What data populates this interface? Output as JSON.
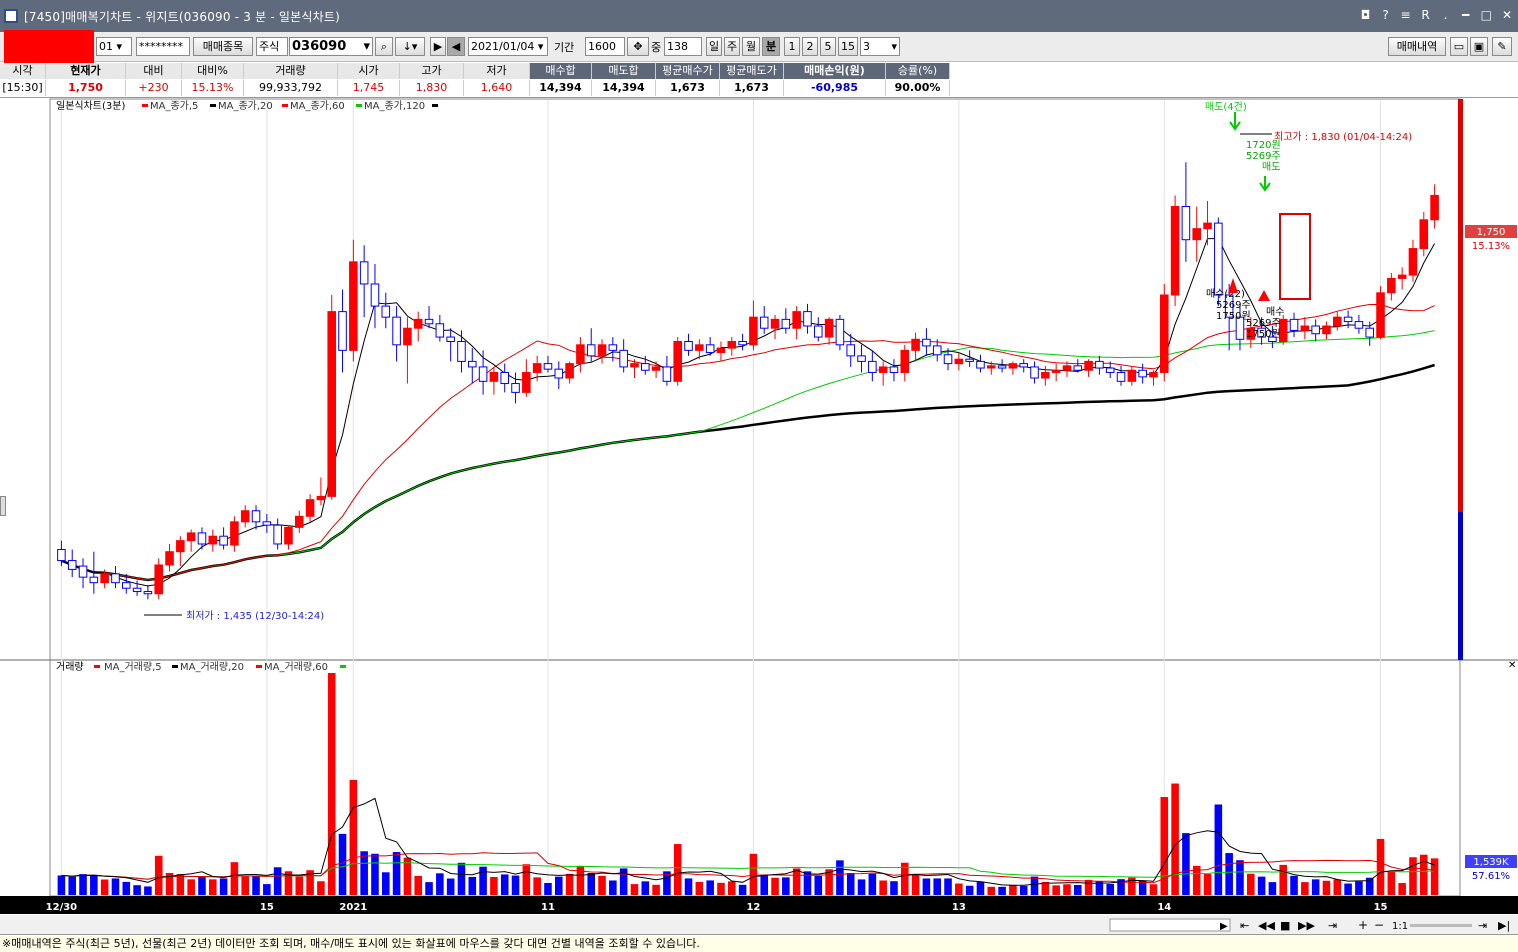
{
  "window": {
    "title": "[7450]매매복기차트 - 위지트(036090 - 3 분 - 일본식차트)",
    "controls": [
      "◘",
      "?",
      "≡",
      "R",
      ".",
      "━",
      "□",
      "✕"
    ]
  },
  "toolbar": {
    "account_suffix": "01",
    "password": "********",
    "trade_items_btn": "매매종목",
    "market_select": "주식",
    "code": "036090",
    "date": "2021/01/04",
    "period_label": "기간",
    "period_value": "1600",
    "weight_label": "중",
    "weight_value": "138",
    "periods": [
      "일",
      "주",
      "월",
      "분",
      "1",
      "2",
      "5",
      "15"
    ],
    "selected_period": "분",
    "interval": "3",
    "trade_history_btn": "매매내역"
  },
  "quote": {
    "headers": [
      "시각",
      "현재가",
      "대비",
      "대비%",
      "거래량",
      "시가",
      "고가",
      "저가",
      "매수합",
      "매도합",
      "평균매수가",
      "평균매도가",
      "매매손익(원)",
      "승률(%)"
    ],
    "values": [
      "[15:30]",
      "1,750",
      "+230",
      "15.13%",
      "99,933,792",
      "1,745",
      "1,830",
      "1,640",
      "14,394",
      "14,394",
      "1,673",
      "1,673",
      "-60,985",
      "90.00%"
    ]
  },
  "price_chart": {
    "legend": [
      {
        "text": "일본식차트(3분)",
        "color": "#000000"
      },
      {
        "text": "MA_종가,5",
        "color": "#ff0000"
      },
      {
        "text": "MA_종가,20",
        "color": "#000000"
      },
      {
        "text": "MA_종가,60",
        "color": "#ff0000"
      },
      {
        "text": "MA_종가,120",
        "color": "#00cc00"
      }
    ],
    "high_annotation": "최고가 : 1,830 (01/04-14:24)",
    "low_annotation": "최저가 : 1,435 (12/30-14:24)",
    "sell_count_label": "매도(4건)",
    "sell_detail": [
      "1720원",
      "5269주",
      "매도"
    ],
    "buy_detail_left": [
      "매수(22)",
      "5269주",
      "1750원"
    ],
    "buy_detail_right": [
      "매수",
      "5269주",
      "1750원"
    ],
    "current_price_badge": "1,750",
    "current_change_badge": "15.13%"
  },
  "volume_chart": {
    "legend": [
      {
        "text": "거래량",
        "color": "#000000"
      },
      {
        "text": "MA_거래량,5",
        "color": "#ff0000"
      },
      {
        "text": "MA_거래량,20",
        "color": "#000000"
      },
      {
        "text": "MA_거래량,60",
        "color": "#ff0000"
      }
    ],
    "current_volume_badge": "1,539K",
    "current_volume_pct": "57.61%"
  },
  "xaxis": {
    "labels": [
      "12/30",
      "15",
      "2021",
      "11",
      "12",
      "13",
      "14",
      "15"
    ]
  },
  "bottom_controls": {
    "zoom_label": "1:1"
  },
  "footer_text": "※매매내역은 주식(최근 5년), 선물(최근 2년) 데이터만 조회 되며, 매수/매도 표시에 있는 화살표에 마우스를 갖다 대면 건별 내역을 조회할 수 있습니다.",
  "colors": {
    "up": "#ff0000",
    "down": "#0000ff",
    "ma120": "#000000",
    "ma60": "#00cc00"
  },
  "chart_data": {
    "type": "candlestick",
    "title": "일본식차트(3분)",
    "ylim": [
      1400,
      1870
    ],
    "x_labels": [
      "12/30",
      "15",
      "2021",
      "11",
      "12",
      "13",
      "14",
      "15"
    ],
    "candles_ohlc": [
      [
        1480,
        1488,
        1465,
        1470
      ],
      [
        1470,
        1480,
        1455,
        1462
      ],
      [
        1465,
        1472,
        1445,
        1455
      ],
      [
        1455,
        1478,
        1440,
        1450
      ],
      [
        1450,
        1462,
        1445,
        1458
      ],
      [
        1458,
        1465,
        1445,
        1450
      ],
      [
        1450,
        1458,
        1440,
        1445
      ],
      [
        1445,
        1452,
        1438,
        1442
      ],
      [
        1442,
        1448,
        1435,
        1440
      ],
      [
        1440,
        1472,
        1435,
        1466
      ],
      [
        1466,
        1485,
        1460,
        1478
      ],
      [
        1478,
        1492,
        1465,
        1488
      ],
      [
        1488,
        1498,
        1478,
        1495
      ],
      [
        1495,
        1500,
        1480,
        1485
      ],
      [
        1485,
        1498,
        1478,
        1492
      ],
      [
        1492,
        1500,
        1480,
        1484
      ],
      [
        1484,
        1510,
        1478,
        1505
      ],
      [
        1505,
        1520,
        1500,
        1515
      ],
      [
        1515,
        1520,
        1498,
        1505
      ],
      [
        1505,
        1512,
        1495,
        1502
      ],
      [
        1502,
        1508,
        1480,
        1485
      ],
      [
        1485,
        1502,
        1480,
        1500
      ],
      [
        1500,
        1515,
        1495,
        1510
      ],
      [
        1510,
        1530,
        1505,
        1525
      ],
      [
        1525,
        1545,
        1520,
        1528
      ],
      [
        1528,
        1710,
        1525,
        1695
      ],
      [
        1695,
        1715,
        1640,
        1660
      ],
      [
        1660,
        1760,
        1650,
        1740
      ],
      [
        1740,
        1755,
        1690,
        1720
      ],
      [
        1720,
        1738,
        1680,
        1700
      ],
      [
        1700,
        1712,
        1680,
        1690
      ],
      [
        1690,
        1700,
        1650,
        1665
      ],
      [
        1665,
        1690,
        1630,
        1680
      ],
      [
        1680,
        1695,
        1668,
        1688
      ],
      [
        1688,
        1700,
        1680,
        1684
      ],
      [
        1684,
        1692,
        1668,
        1672
      ],
      [
        1672,
        1680,
        1650,
        1668
      ],
      [
        1668,
        1678,
        1640,
        1650
      ],
      [
        1650,
        1662,
        1630,
        1645
      ],
      [
        1645,
        1660,
        1620,
        1632
      ],
      [
        1632,
        1644,
        1620,
        1640
      ],
      [
        1640,
        1648,
        1622,
        1630
      ],
      [
        1630,
        1640,
        1612,
        1622
      ],
      [
        1622,
        1652,
        1618,
        1640
      ],
      [
        1640,
        1655,
        1632,
        1648
      ],
      [
        1648,
        1655,
        1640,
        1643
      ],
      [
        1643,
        1650,
        1625,
        1635
      ],
      [
        1635,
        1650,
        1630,
        1648
      ],
      [
        1648,
        1672,
        1640,
        1665
      ],
      [
        1665,
        1680,
        1650,
        1655
      ],
      [
        1655,
        1670,
        1648,
        1665
      ],
      [
        1665,
        1672,
        1650,
        1660
      ],
      [
        1660,
        1670,
        1640,
        1645
      ],
      [
        1645,
        1652,
        1635,
        1648
      ],
      [
        1648,
        1655,
        1638,
        1642
      ],
      [
        1642,
        1650,
        1635,
        1645
      ],
      [
        1645,
        1655,
        1628,
        1632
      ],
      [
        1632,
        1672,
        1628,
        1668
      ],
      [
        1668,
        1675,
        1655,
        1660
      ],
      [
        1660,
        1670,
        1652,
        1665
      ],
      [
        1665,
        1672,
        1655,
        1658
      ],
      [
        1658,
        1668,
        1650,
        1662
      ],
      [
        1662,
        1672,
        1655,
        1668
      ],
      [
        1668,
        1675,
        1660,
        1665
      ],
      [
        1665,
        1705,
        1660,
        1690
      ],
      [
        1690,
        1700,
        1675,
        1680
      ],
      [
        1680,
        1692,
        1670,
        1688
      ],
      [
        1688,
        1698,
        1675,
        1680
      ],
      [
        1680,
        1700,
        1670,
        1695
      ],
      [
        1695,
        1702,
        1675,
        1682
      ],
      [
        1682,
        1690,
        1668,
        1672
      ],
      [
        1672,
        1690,
        1665,
        1688
      ],
      [
        1688,
        1692,
        1660,
        1665
      ],
      [
        1665,
        1675,
        1645,
        1655
      ],
      [
        1655,
        1665,
        1640,
        1650
      ],
      [
        1650,
        1660,
        1632,
        1640
      ],
      [
        1640,
        1650,
        1628,
        1645
      ],
      [
        1645,
        1652,
        1632,
        1640
      ],
      [
        1640,
        1665,
        1632,
        1660
      ],
      [
        1660,
        1676,
        1650,
        1670
      ],
      [
        1670,
        1680,
        1655,
        1664
      ],
      [
        1664,
        1670,
        1650,
        1656
      ],
      [
        1656,
        1662,
        1642,
        1648
      ],
      [
        1648,
        1658,
        1642,
        1652
      ],
      [
        1652,
        1660,
        1645,
        1650
      ],
      [
        1650,
        1656,
        1640,
        1644
      ],
      [
        1644,
        1650,
        1638,
        1646
      ],
      [
        1646,
        1652,
        1640,
        1644
      ],
      [
        1644,
        1650,
        1638,
        1648
      ],
      [
        1648,
        1652,
        1640,
        1645
      ],
      [
        1645,
        1650,
        1630,
        1635
      ],
      [
        1635,
        1646,
        1628,
        1640
      ],
      [
        1640,
        1648,
        1632,
        1642
      ],
      [
        1642,
        1650,
        1636,
        1646
      ],
      [
        1646,
        1652,
        1640,
        1642
      ],
      [
        1642,
        1652,
        1636,
        1650
      ],
      [
        1650,
        1655,
        1638,
        1644
      ],
      [
        1644,
        1650,
        1635,
        1640
      ],
      [
        1640,
        1646,
        1628,
        1632
      ],
      [
        1632,
        1645,
        1628,
        1642
      ],
      [
        1642,
        1648,
        1630,
        1636
      ],
      [
        1636,
        1642,
        1628,
        1640
      ],
      [
        1640,
        1720,
        1632,
        1710
      ],
      [
        1710,
        1800,
        1700,
        1790
      ],
      [
        1790,
        1830,
        1740,
        1760
      ],
      [
        1760,
        1790,
        1740,
        1770
      ],
      [
        1770,
        1795,
        1755,
        1775
      ],
      [
        1775,
        1780,
        1700,
        1710
      ],
      [
        1710,
        1720,
        1660,
        1690
      ],
      [
        1690,
        1700,
        1660,
        1670
      ],
      [
        1670,
        1690,
        1662,
        1680
      ],
      [
        1680,
        1690,
        1665,
        1672
      ],
      [
        1672,
        1682,
        1662,
        1668
      ],
      [
        1668,
        1692,
        1665,
        1688
      ],
      [
        1688,
        1694,
        1672,
        1678
      ],
      [
        1678,
        1690,
        1670,
        1682
      ],
      [
        1682,
        1688,
        1668,
        1675
      ],
      [
        1675,
        1686,
        1670,
        1682
      ],
      [
        1682,
        1695,
        1678,
        1690
      ],
      [
        1690,
        1696,
        1680,
        1686
      ],
      [
        1686,
        1692,
        1675,
        1680
      ],
      [
        1680,
        1686,
        1664,
        1672
      ],
      [
        1672,
        1718,
        1670,
        1712
      ],
      [
        1712,
        1730,
        1705,
        1725
      ],
      [
        1725,
        1735,
        1715,
        1728
      ],
      [
        1728,
        1760,
        1722,
        1752
      ],
      [
        1752,
        1785,
        1745,
        1778
      ],
      [
        1778,
        1810,
        1770,
        1800
      ]
    ]
  }
}
